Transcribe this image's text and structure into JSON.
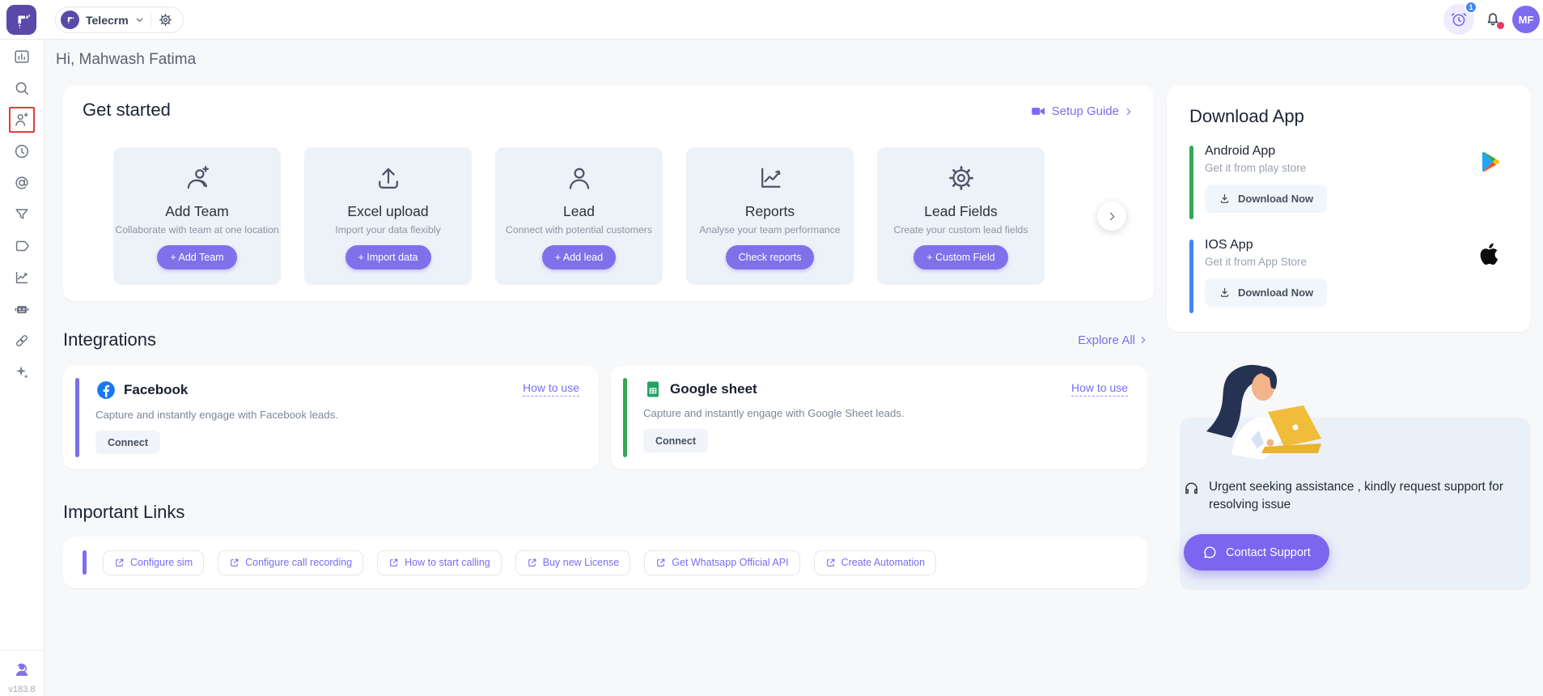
{
  "topbar": {
    "workspace": "Telecrm",
    "alarm_badge": "1",
    "avatar_initials": "MF"
  },
  "greeting": "Hi, Mahwash Fatima",
  "sidebar": {
    "icons": [
      "dashboard-icon",
      "search-icon",
      "add-user-icon",
      "recent-activity-icon",
      "mentions-icon",
      "filter-icon",
      "tags-icon",
      "analytics-icon",
      "automation-bot-icon",
      "integration-link-icon",
      "ai-sparkle-icon"
    ],
    "active_icon": "add-user-icon",
    "version": "v183.8"
  },
  "get_started": {
    "title": "Get started",
    "setup_guide_label": "Setup Guide",
    "cards": [
      {
        "title": "Add Team",
        "description": "Collaborate with team at one location",
        "button": "+ Add Team"
      },
      {
        "title": "Excel upload",
        "description": "Import your data flexibly",
        "button": "+ Import data"
      },
      {
        "title": "Lead",
        "description": "Connect with potential customers",
        "button": "+ Add lead"
      },
      {
        "title": "Reports",
        "description": "Analyse your team performance",
        "button": "Check reports"
      },
      {
        "title": "Lead Fields",
        "description": "Create your custom lead fields",
        "button": "+ Custom Field"
      }
    ]
  },
  "integrations": {
    "title": "Integrations",
    "explore_all_label": "Explore All",
    "cards": [
      {
        "name": "Facebook",
        "how_to_use": "How to use",
        "description": "Capture and instantly engage with Facebook leads.",
        "connect": "Connect"
      },
      {
        "name": "Google sheet",
        "how_to_use": "How to use",
        "description": "Capture and instantly engage with Google Sheet leads.",
        "connect": "Connect"
      }
    ]
  },
  "important_links": {
    "title": "Important Links",
    "links": [
      "Configure sim",
      "Configure call recording",
      "How to start calling",
      "Buy new License",
      "Get Whatsapp Official API",
      "Create Automation"
    ]
  },
  "download_app": {
    "title": "Download App",
    "apps": [
      {
        "name": "Android App",
        "subtitle": "Get it from play store",
        "button": "Download Now"
      },
      {
        "name": "IOS App",
        "subtitle": "Get it from App Store",
        "button": "Download Now"
      }
    ]
  },
  "support": {
    "message": "Urgent seeking assistance , kindly request support for resolving issue",
    "button": "Contact Support"
  },
  "colors": {
    "primary_purple": "#8170E9",
    "link_purple": "#7B6CF2",
    "facebook_blue": "#1877F2",
    "google_sheet_green": "#1FA463",
    "android_accent": "#34A853",
    "ios_accent": "#4285F4",
    "alarm_badge_blue": "#4285F4",
    "notification_dot_red": "#E8385F",
    "highlight_box_red": "#E23B3B"
  }
}
